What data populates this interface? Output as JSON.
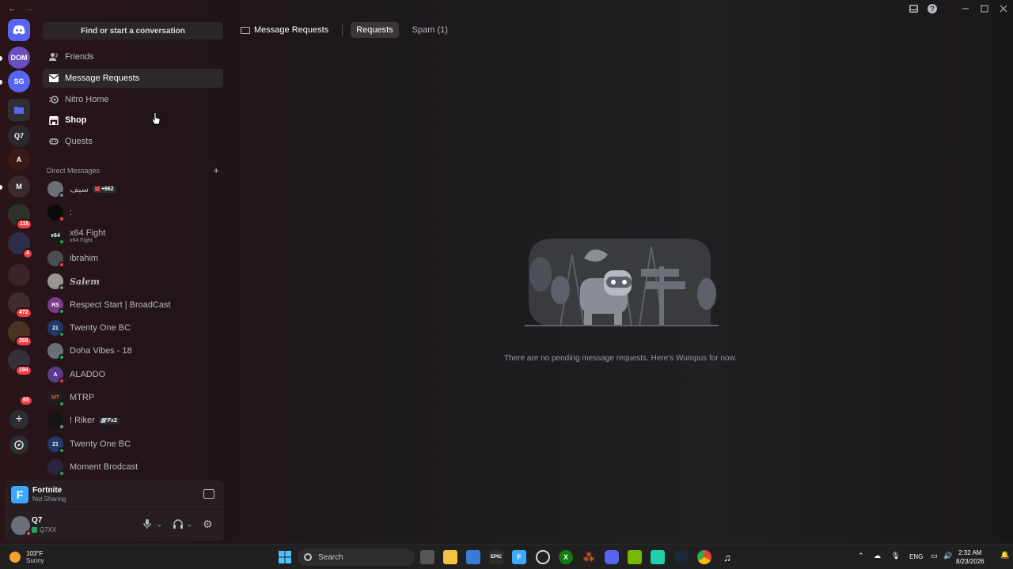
{
  "titlebar": {
    "back": "←",
    "forward": "→"
  },
  "rail": {
    "servers": [
      {
        "initials": "DOM",
        "color": "#3b3f56"
      },
      {
        "initials": "SG",
        "color": "#6b4fbf"
      },
      {
        "initials": "",
        "color": "#5865f2"
      },
      {
        "initials": "Q7",
        "color": "#2e2e33"
      },
      {
        "initials": "A",
        "color": "#2a2a2e"
      },
      {
        "initials": "M",
        "color": "#3a1a14"
      },
      {
        "initials": "",
        "color": "#3a2a2e"
      },
      {
        "initials": "",
        "color": "#2c3326"
      },
      {
        "initials": "",
        "color": "#2d2f4a"
      },
      {
        "initials": "",
        "color": "#3a2429"
      },
      {
        "initials": "",
        "color": "#402c30"
      },
      {
        "initials": "",
        "color": "#4a3322"
      },
      {
        "initials": "",
        "color": "#33303a"
      }
    ],
    "badges": [
      "115",
      "4",
      "472",
      "258",
      "194",
      "65"
    ]
  },
  "dm": {
    "search_placeholder": "Find or start a conversation",
    "nav": [
      {
        "label": "Friends",
        "icon": "friends-icon"
      },
      {
        "label": "Message Requests",
        "icon": "mail-icon"
      },
      {
        "label": "Nitro Home",
        "icon": "nitro-icon"
      },
      {
        "label": "Shop",
        "icon": "shop-icon"
      },
      {
        "label": "Quests",
        "icon": "quests-icon"
      }
    ],
    "section_title": "Direct Messages",
    "conversations": [
      {
        "name": "سيف",
        "badge": "+962",
        "sub": "",
        "status": "offline",
        "color": "#6b6f78",
        "initials": ""
      },
      {
        "name": ":",
        "badge": "",
        "sub": "",
        "status": "dnd",
        "color": "#0b0b0b",
        "initials": ""
      },
      {
        "name": "x64 Fight",
        "badge": "",
        "sub": "x64 Fight",
        "status": "online",
        "color": "#1a1a1a",
        "initials": "x64"
      },
      {
        "name": "ibrahim",
        "badge": "",
        "sub": "",
        "status": "dnd",
        "color": "#4a4d52",
        "initials": ""
      },
      {
        "name": "𝑺𝒂𝒍𝒆𝒎",
        "badge": "",
        "sub": "",
        "status": "offline",
        "color": "#9a9690",
        "initials": ""
      },
      {
        "name": "Respect Start | BroadCast",
        "badge": "",
        "sub": "",
        "status": "online",
        "color": "#7a3a8c",
        "initials": "RS"
      },
      {
        "name": "Twenty One BC",
        "badge": "",
        "sub": "",
        "status": "online",
        "color": "#1f3a6b",
        "initials": "21"
      },
      {
        "name": "Doha Vibes - 18",
        "badge": "",
        "sub": "",
        "status": "online",
        "color": "#6a6f7a",
        "initials": ""
      },
      {
        "name": "ALADDO",
        "badge": "",
        "sub": "",
        "status": "dnd",
        "color": "#5a3a8c",
        "initials": "A"
      },
      {
        "name": "MTRP",
        "badge": "",
        "sub": "",
        "status": "online",
        "color": "#1e1e1e",
        "initials": "MT"
      },
      {
        "name": "! Riker",
        "badge": "Fx2",
        "sub": "",
        "status": "offline",
        "color": "#151515",
        "initials": ""
      },
      {
        "name": "Twenty One BC",
        "badge": "",
        "sub": "",
        "status": "online",
        "color": "#1f3a6b",
        "initials": "21"
      },
      {
        "name": "Moment Brodcast",
        "badge": "",
        "sub": "",
        "status": "online",
        "color": "#2c2340",
        "initials": ""
      }
    ]
  },
  "activity": {
    "icon_letter": "F",
    "title": "Fortnite",
    "subtitle": "Not Sharing"
  },
  "user": {
    "name": "Q7",
    "tag": "Q7XX"
  },
  "main": {
    "title": "Message Requests",
    "tabs": [
      "Requests",
      "Spam (1)"
    ],
    "empty_text": "There are no pending message requests. Here's Wumpus for now."
  },
  "taskbar": {
    "weather_temp": "103°F",
    "weather_desc": "Sunny",
    "search_label": "Search",
    "tray_lang": "ENG",
    "time": "2:32 AM",
    "date": "8/23/2026"
  }
}
